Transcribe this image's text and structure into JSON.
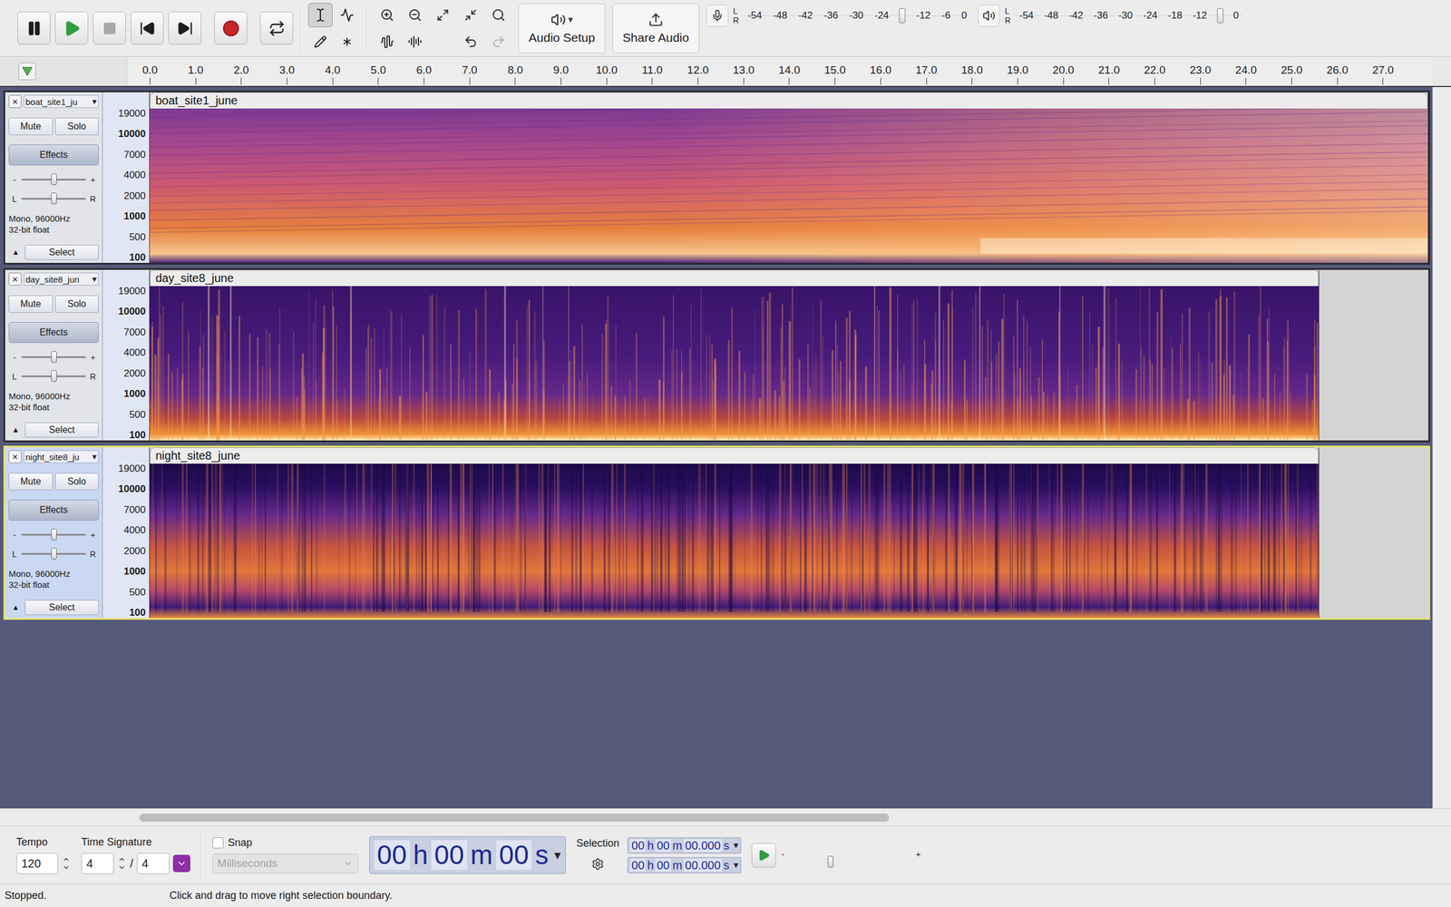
{
  "transport": [
    {
      "kind": "pause",
      "disabled": false
    },
    {
      "kind": "play",
      "disabled": false
    },
    {
      "kind": "stop",
      "disabled": true
    },
    {
      "kind": "skip-start",
      "disabled": false
    },
    {
      "kind": "skip-end",
      "disabled": false
    },
    {
      "kind": "record",
      "disabled": false
    },
    {
      "kind": "loop",
      "disabled": false
    }
  ],
  "tools": [
    {
      "kind": "select",
      "selected": true
    },
    {
      "kind": "envelope",
      "selected": false
    },
    {
      "kind": "draw",
      "selected": false
    },
    {
      "kind": "multi",
      "selected": false
    }
  ],
  "edit_tools": [
    {
      "kind": "zoom-in",
      "disabled": false
    },
    {
      "kind": "zoom-out",
      "disabled": false
    },
    {
      "kind": "fit-selection",
      "disabled": false
    },
    {
      "kind": "fit-project",
      "disabled": false
    },
    {
      "kind": "zoom-toggle",
      "disabled": false
    },
    {
      "kind": "trim",
      "disabled": false
    },
    {
      "kind": "silence",
      "disabled": false
    },
    {
      "kind": "undo",
      "disabled": false
    },
    {
      "kind": "redo",
      "disabled": true
    }
  ],
  "audio_setup": {
    "label": "Audio Setup",
    "arrow": "▾"
  },
  "share_audio": {
    "label": "Share Audio"
  },
  "meters": [
    {
      "kind": "record",
      "channels": [
        "L",
        "R"
      ],
      "ticks": [
        "-54",
        "-48",
        "-42",
        "-36",
        "-30",
        "-24",
        "-12",
        "-6",
        "0"
      ],
      "level": 0.7
    },
    {
      "kind": "playback",
      "channels": [
        "L",
        "R"
      ],
      "ticks": [
        "-54",
        "-48",
        "-42",
        "-36",
        "-30",
        "-24",
        "-18",
        "-12",
        "0"
      ],
      "level": 0.9
    }
  ],
  "ruler": {
    "ticks": [
      "0.0",
      "1.0",
      "2.0",
      "3.0",
      "4.0",
      "5.0",
      "6.0",
      "7.0",
      "8.0",
      "9.0",
      "10.0",
      "11.0",
      "12.0",
      "13.0",
      "14.0",
      "15.0",
      "16.0",
      "17.0",
      "18.0",
      "19.0",
      "20.0",
      "21.0",
      "22.0",
      "23.0",
      "24.0",
      "25.0",
      "26.0",
      "27.0"
    ]
  },
  "tracks": [
    {
      "name": "boat_site1_ju",
      "menu_arrow": "▾",
      "close": "×",
      "clip": "boat_site1_june",
      "selected": false,
      "mute": "Mute",
      "solo": "Solo",
      "muted": false,
      "soloed": false,
      "effects": "Effects",
      "gain": {
        "min": "-",
        "max": "+",
        "level": 0.5
      },
      "pan": {
        "min": "L",
        "max": "R",
        "level": 0.5
      },
      "format": [
        "Mono, 96000Hz",
        "32-bit float"
      ],
      "collapse": "▲",
      "select": "Select",
      "scale": [
        {
          "label": "19000",
          "major": false
        },
        {
          "label": "10000",
          "major": true
        },
        {
          "label": "7000",
          "major": false
        },
        {
          "label": "4000",
          "major": false
        },
        {
          "label": "2000",
          "major": false
        },
        {
          "label": "1000",
          "major": true
        },
        {
          "label": "500",
          "major": false
        },
        {
          "label": "100",
          "major": true
        }
      ],
      "spectrogram": "boat",
      "duration": 28.0
    },
    {
      "name": "day_site8_jun",
      "menu_arrow": "▾",
      "close": "×",
      "clip": "day_site8_june",
      "selected": false,
      "mute": "Mute",
      "solo": "Solo",
      "muted": false,
      "soloed": false,
      "effects": "Effects",
      "gain": {
        "min": "-",
        "max": "+",
        "level": 0.5
      },
      "pan": {
        "min": "L",
        "max": "R",
        "level": 0.5
      },
      "format": [
        "Mono, 96000Hz",
        "32-bit float"
      ],
      "collapse": "▲",
      "select": "Select",
      "scale": [
        {
          "label": "19000",
          "major": false
        },
        {
          "label": "10000",
          "major": true
        },
        {
          "label": "7000",
          "major": false
        },
        {
          "label": "4000",
          "major": false
        },
        {
          "label": "2000",
          "major": false
        },
        {
          "label": "1000",
          "major": true
        },
        {
          "label": "500",
          "major": false
        },
        {
          "label": "100",
          "major": true
        }
      ],
      "spectrogram": "day",
      "duration": 25.6
    },
    {
      "name": "night_site8_ju",
      "menu_arrow": "▾",
      "close": "×",
      "clip": "night_site8_june",
      "selected": true,
      "mute": "Mute",
      "solo": "Solo",
      "muted": false,
      "soloed": false,
      "effects": "Effects",
      "gain": {
        "min": "-",
        "max": "+",
        "level": 0.5
      },
      "pan": {
        "min": "L",
        "max": "R",
        "level": 0.5
      },
      "format": [
        "Mono, 96000Hz",
        "32-bit float"
      ],
      "collapse": "▲",
      "select": "Select",
      "scale": [
        {
          "label": "19000",
          "major": false
        },
        {
          "label": "10000",
          "major": true
        },
        {
          "label": "7000",
          "major": false
        },
        {
          "label": "4000",
          "major": false
        },
        {
          "label": "2000",
          "major": false
        },
        {
          "label": "1000",
          "major": true
        },
        {
          "label": "500",
          "major": false
        },
        {
          "label": "100",
          "major": true
        }
      ],
      "spectrogram": "night",
      "duration": 25.6
    }
  ],
  "horizontal_scrollbar": {
    "level": 0.58
  },
  "bottom_bar": {
    "tempo": {
      "label": "Tempo",
      "value": "120"
    },
    "time_signature": {
      "label": "Time Signature",
      "upper": "4",
      "separator": "/",
      "lower": "4"
    },
    "snap": {
      "label": "Snap",
      "checked": false,
      "unit": "Milliseconds",
      "disabled": true
    },
    "time": {
      "parts": [
        "00",
        "h",
        "00",
        "m",
        "00",
        "s"
      ],
      "arrow": "▾"
    },
    "selection": {
      "label": "Selection",
      "start": [
        "00",
        "h",
        "00",
        "m",
        "00.000",
        "s"
      ],
      "end": [
        "00",
        "h",
        "00",
        "m",
        "00.000",
        "s"
      ],
      "arrow": "▾"
    },
    "play_at_speed": {
      "min": "-",
      "max": "+",
      "level": 0.35
    }
  },
  "status_bar": {
    "state": "Stopped.",
    "message": "Click and drag to move right selection boundary."
  }
}
